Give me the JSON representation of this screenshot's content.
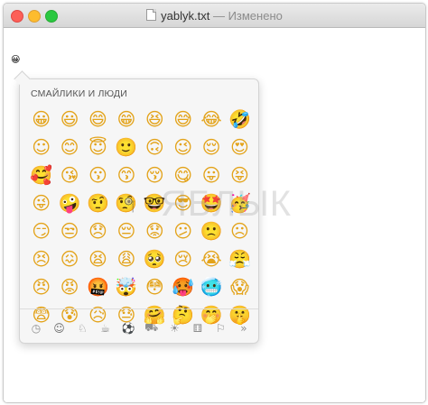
{
  "window": {
    "filename": "yablyk.txt",
    "separator": " — ",
    "status": "Изменено"
  },
  "document": {
    "content_emoji": "😀"
  },
  "watermark": "ЯБЛЫК",
  "emoji_picker": {
    "category_title": "СМАЙЛИКИ И ЛЮДИ",
    "emojis": [
      "😀",
      "😃",
      "😄",
      "😁",
      "😆",
      "😅",
      "😂",
      "🤣",
      "☺",
      "😊",
      "😇",
      "🙂",
      "🙃",
      "😉",
      "😌",
      "😍",
      "🥰",
      "😘",
      "😗",
      "😙",
      "😚",
      "😋",
      "😛",
      "😝",
      "😜",
      "🤪",
      "🤨",
      "🧐",
      "🤓",
      "😎",
      "🤩",
      "🥳",
      "😏",
      "😒",
      "😞",
      "😔",
      "😟",
      "😕",
      "🙁",
      "☹",
      "😣",
      "😖",
      "😫",
      "😩",
      "🥺",
      "😢",
      "😭",
      "😤",
      "😠",
      "😡",
      "🤬",
      "🤯",
      "😳",
      "🥵",
      "🥶",
      "😱",
      "😨",
      "😰",
      "😥",
      "😓",
      "🤗",
      "🤔",
      "🤭",
      "🤫"
    ],
    "categories": [
      {
        "icon": "clock-icon",
        "glyph": "◷"
      },
      {
        "icon": "smiley-icon",
        "glyph": "☺"
      },
      {
        "icon": "animal-icon",
        "glyph": "♘"
      },
      {
        "icon": "food-icon",
        "glyph": "☕"
      },
      {
        "icon": "activity-icon",
        "glyph": "⚽"
      },
      {
        "icon": "travel-icon",
        "glyph": "⛟"
      },
      {
        "icon": "objects-icon",
        "glyph": "☀"
      },
      {
        "icon": "symbols-icon",
        "glyph": "⚅"
      },
      {
        "icon": "flag-icon",
        "glyph": "⚐"
      },
      {
        "icon": "more-icon",
        "glyph": "»"
      }
    ]
  }
}
